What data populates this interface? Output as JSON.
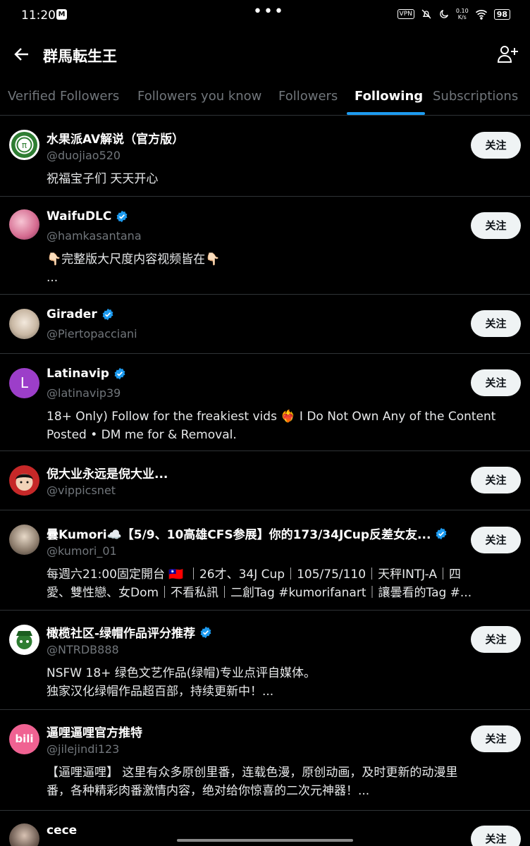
{
  "status": {
    "time": "11:20",
    "vpn": "VPN",
    "speed_value": "0.10",
    "speed_unit": "K/s",
    "battery": "98"
  },
  "header": {
    "title": "群馬転生王"
  },
  "tabs": [
    "Verified Followers",
    "Followers you know",
    "Followers",
    "Following",
    "Subscriptions"
  ],
  "active_tab": "Following",
  "follow_label": "关注",
  "users": [
    {
      "name": "水果派AV解说（官方版）",
      "verified": false,
      "handle": "@duojiao520",
      "bio": [
        "祝福宝子们 天天开心"
      ]
    },
    {
      "name": "WaifuDLC",
      "verified": true,
      "handle": "@hamkasantana",
      "bio": [
        "👇🏻完整版大尺度内容视频皆在👇🏻",
        "..."
      ]
    },
    {
      "name": "Girader",
      "verified": true,
      "handle": "@Piertopacciani",
      "bio": []
    },
    {
      "name": "Latinavip",
      "verified": true,
      "handle": "@latinavip39",
      "avatar_letter": "L",
      "bio": [
        "18+ Only) Follow for the freakiest vids ❤️‍🔥 I Do Not Own Any of the Content",
        "Posted • DM me for & Removal."
      ]
    },
    {
      "name": "倪大业永远是倪大业...",
      "verified": false,
      "handle": "@vippicsnet",
      "bio": []
    },
    {
      "name": "曇Kumori☁️【5/9、10高雄CFS参展】你的173/34JCup反差女友...",
      "verified": true,
      "handle": "@kumori_01",
      "bio": [
        "每週六21:00固定開台 🇹🇼 ｜26才、34J Cup｜105/75/110｜天秤INTJ-A｜四",
        "愛、雙性戀、女Dom｜不看私訊｜二創Tag #kumorifanart｜讓曇看的Tag #..."
      ]
    },
    {
      "name": "橄榄社区-绿帽作品评分推荐",
      "verified": true,
      "handle": "@NTRDB888",
      "bio": [
        "NSFW 18+  绿色文艺作品(绿帽)专业点评自媒体。",
        "独家汉化绿帽作品超百部，持续更新中！..."
      ]
    },
    {
      "name": "逼哩逼哩官方推特",
      "verified": false,
      "handle": "@jilejindi123",
      "avatar_text": "bili",
      "bio": [
        "【逼哩逼哩】 这里有众多原创里番，连载色漫，原创动画，及时更新的动漫里",
        "番，各种精彩肉番激情内容，绝对给你惊喜的二次元神器！..."
      ]
    },
    {
      "name": "cece",
      "verified": false,
      "handle": "",
      "bio": []
    }
  ],
  "colors": {
    "accent": "#1d9bf0",
    "background": "#000000",
    "muted": "#71767b",
    "divider": "#2f3336"
  }
}
